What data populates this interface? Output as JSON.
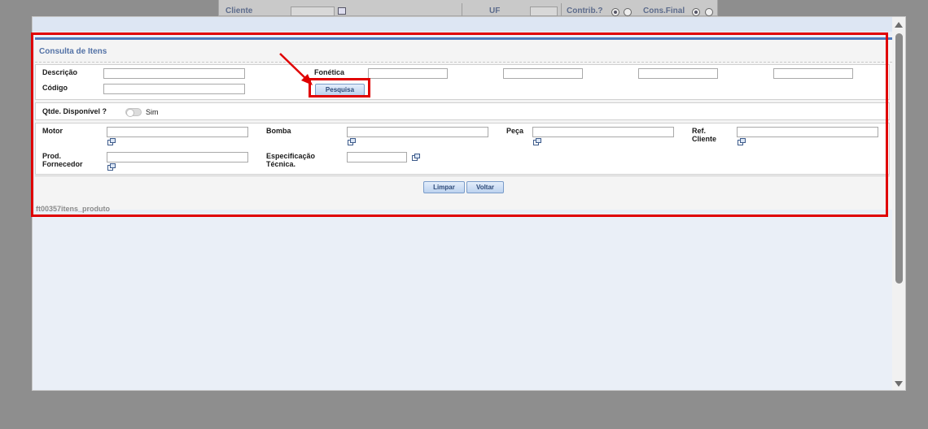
{
  "background_form": {
    "cliente_label": "Cliente",
    "uf_label": "UF",
    "contrib_label": "Contrib.?",
    "cons_final_label": "Cons.Final"
  },
  "modal": {
    "title": "Consulta de Itens",
    "search": {
      "descricao_label": "Descrição",
      "descricao_value": "",
      "codigo_label": "Código",
      "codigo_value": "",
      "fonetica_label": "Fonética",
      "fonetica_values": [
        "",
        "",
        "",
        ""
      ],
      "pesquisa_button": "Pesquisa"
    },
    "availability": {
      "label": "Qtde. Disponível ?",
      "toggle_label": "Sim",
      "toggle_on": false
    },
    "filters": {
      "motor_label": "Motor",
      "bomba_label": "Bomba",
      "peca_label": "Peça",
      "ref_cliente_label_1": "Ref.",
      "ref_cliente_label_2": "Cliente",
      "prod_fornecedor_label_1": "Prod.",
      "prod_fornecedor_label_2": "Fornecedor",
      "especificacao_label_1": "Especificação",
      "especificacao_label_2": "Técnica."
    },
    "actions": {
      "limpar_button": "Limpar",
      "voltar_button": "Voltar"
    },
    "footer_id": "ft00357itens_produto"
  },
  "icons": {
    "lookup": "lookup-icon",
    "scroll_up": "scroll-up-arrow-icon",
    "scroll_down": "scroll-down-arrow-icon"
  },
  "colors": {
    "accent": "#4f7bbd",
    "annotation": "#e00000",
    "title": "#5372a6"
  }
}
